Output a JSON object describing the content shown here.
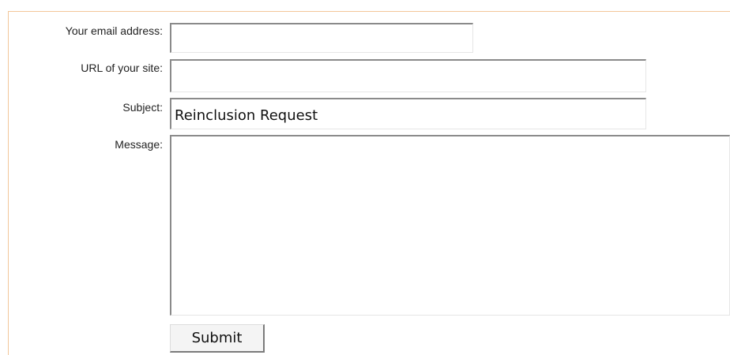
{
  "form": {
    "email": {
      "label": "Your email address:",
      "value": ""
    },
    "url": {
      "label": "URL of your site:",
      "value": ""
    },
    "subject": {
      "label": "Subject:",
      "value": "Reinclusion Request"
    },
    "message": {
      "label": "Message:",
      "value": ""
    },
    "submit_label": "Submit"
  },
  "colors": {
    "frame_border": "#f3c79a",
    "field_border_dark": "#8a8a8a",
    "field_border_light": "#e6e6e6"
  }
}
